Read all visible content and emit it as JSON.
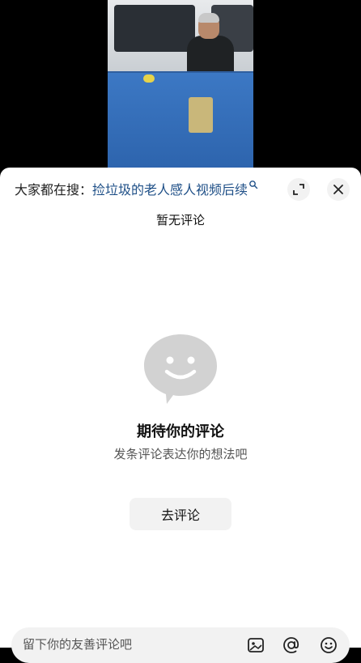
{
  "search": {
    "prefix": "大家都在搜：",
    "query": "捡垃圾的老人感人视频后续"
  },
  "comments": {
    "title": "暂无评论"
  },
  "empty_state": {
    "title": "期待你的评论",
    "subtitle": "发条评论表达你的想法吧",
    "button_label": "去评论"
  },
  "input_bar": {
    "placeholder": "留下你的友善评论吧"
  },
  "icons": [
    "search-icon",
    "expand-icon",
    "close-icon",
    "smiley-bubble-icon",
    "image-icon",
    "at-icon",
    "emoji-icon"
  ],
  "colors": {
    "query_link": "#1e4f87",
    "empty_icon": "#d2d2d2",
    "button_bg": "#f2f2f2"
  }
}
